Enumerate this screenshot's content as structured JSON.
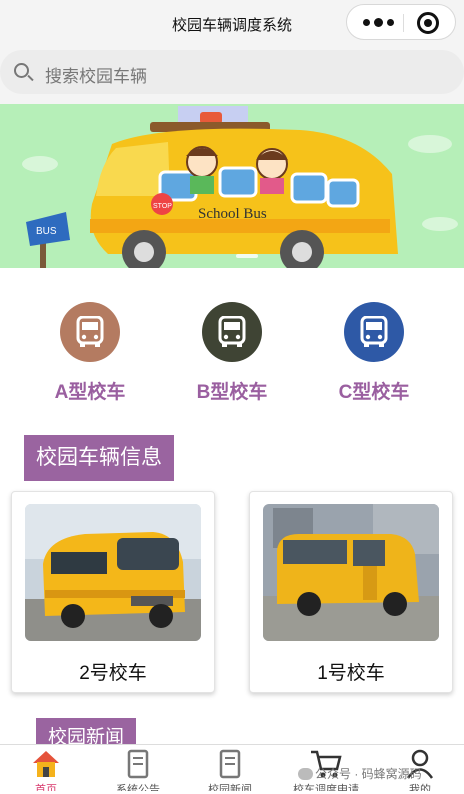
{
  "nav": {
    "title": "校园车辆调度系统"
  },
  "search": {
    "placeholder": "搜索校园车辆"
  },
  "banner": {
    "sign_text": "School Bus",
    "stop_text": "STOP",
    "bus_sign": "BUS",
    "bg_color": "#b6efb8"
  },
  "categories": [
    {
      "label": "A型校车",
      "icon": "bus-icon",
      "color": "#b47b61"
    },
    {
      "label": "B型校车",
      "icon": "bus-icon",
      "color": "#3f4434"
    },
    {
      "label": "C型校车",
      "icon": "bus-icon",
      "color": "#2e59a6"
    }
  ],
  "vehicles_section": {
    "title": "校园车辆信息",
    "cards": [
      {
        "name": "2号校车"
      },
      {
        "name": "1号校车"
      }
    ]
  },
  "news_section": {
    "title": "校园新闻"
  },
  "tabbar": {
    "tabs": [
      {
        "label": "首页",
        "icon": "home-icon",
        "active": true
      },
      {
        "label": "系统公告",
        "icon": "document-icon"
      },
      {
        "label": "校园新闻",
        "icon": "news-icon"
      },
      {
        "label": "校车调度申请",
        "icon": "cart-icon"
      },
      {
        "label": "我的",
        "icon": "user-icon"
      }
    ]
  },
  "watermark": "公众号 · 码蜂窝源码",
  "colors": {
    "accent": "#9a64a0",
    "active_tab": "#d8386c"
  }
}
